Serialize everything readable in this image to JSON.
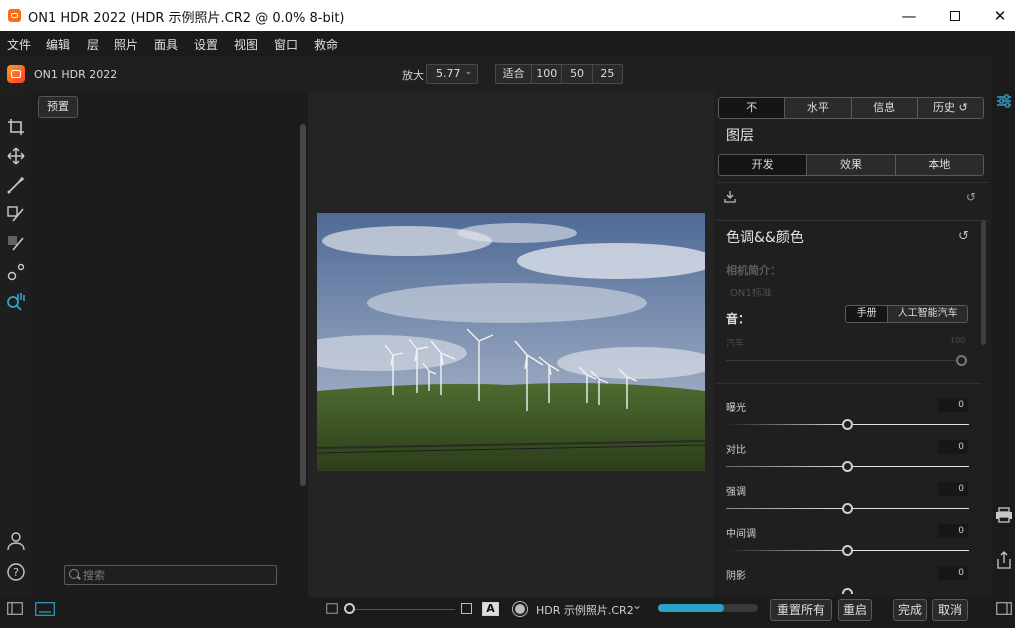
{
  "window": {
    "title": "ON1 HDR 2022 (HDR 示例照片.CR2 @ 0.0% 8-bit)",
    "minimize_icon": "minimize-icon",
    "maximize_icon": "maximize-icon",
    "close_icon": "close-icon"
  },
  "menu": [
    "文件",
    "编辑",
    "层",
    "照片",
    "面具",
    "设置",
    "视图",
    "窗口",
    "救命"
  ],
  "toolbar": {
    "brand": "ON1 HDR 2022",
    "zoom_label": "放大",
    "zoom_value": "5.77",
    "zoom_buttons": [
      "适合",
      "100",
      "50",
      "25"
    ]
  },
  "left_panel": {
    "preset_button": "预置",
    "search_placeholder": "搜索",
    "tools": [
      "crop-icon",
      "move-icon",
      "brush-icon",
      "mask-brush-icon",
      "line-mask-icon",
      "retouch-icon",
      "view-hand-icon"
    ]
  },
  "right_panel": {
    "top_tabs": [
      "不",
      "水平",
      "信息",
      "历史"
    ],
    "layers_title": "图层",
    "module_tabs": [
      "开发",
      "效果",
      "本地"
    ],
    "section_title": "色调&&颜色",
    "camera_profile_label": "相机简介：",
    "camera_profile_value": "ON1标准",
    "tone_label": "音：",
    "tone_modes": [
      "手册",
      "人工智能汽车"
    ],
    "auto_label": "汽车",
    "auto_value": "100",
    "sliders": [
      {
        "label": "曝光",
        "value": "0"
      },
      {
        "label": "对比",
        "value": "0"
      },
      {
        "label": "强调",
        "value": "0"
      },
      {
        "label": "中间调",
        "value": "0"
      },
      {
        "label": "阴影",
        "value": "0"
      }
    ]
  },
  "statusbar": {
    "preview_label": "A",
    "file_name": "HDR 示例照片.CR2",
    "progress": 0.66,
    "buttons": [
      "重置所有",
      "重启",
      "完成",
      "取消"
    ]
  },
  "colors": {
    "accent": "#2ea3c9",
    "panel_bg": "#1f1f1f",
    "canvas_bg": "#242424"
  }
}
